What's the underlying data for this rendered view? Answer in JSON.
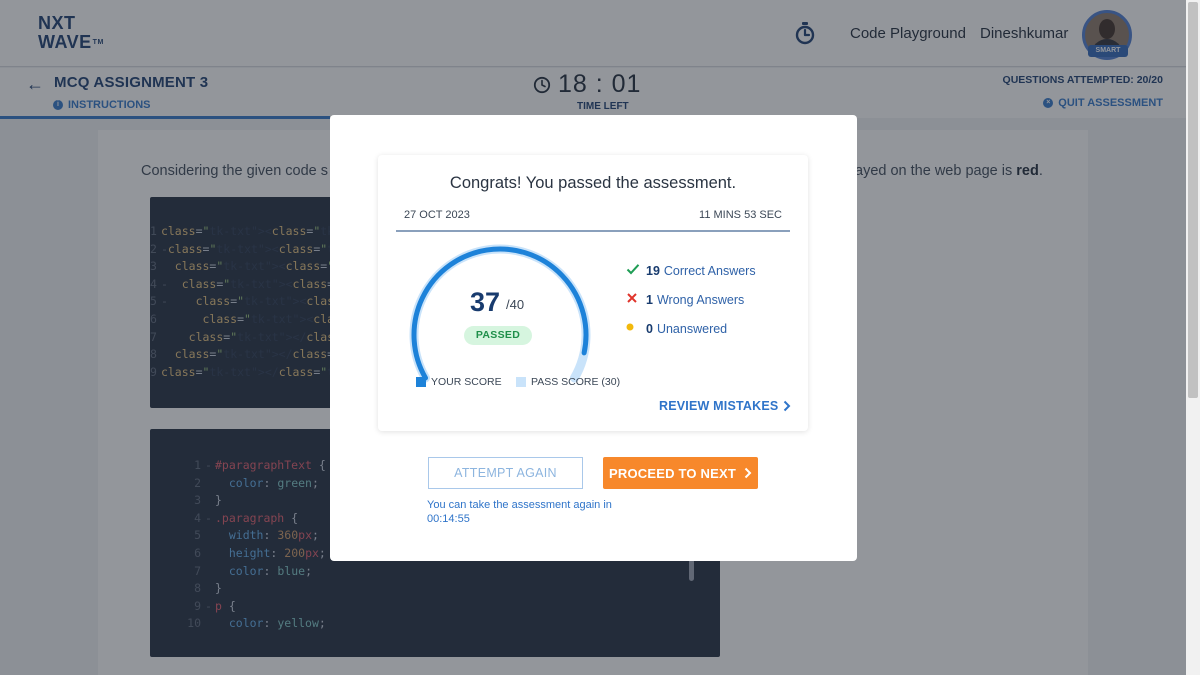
{
  "navbar": {
    "logo_line1": "NXT",
    "logo_line2": "WAVE",
    "logo_tm": "TM",
    "playground_label": "Code Playground",
    "user_name": "Dineshkumar",
    "avatar_badge": "SMART"
  },
  "assignment": {
    "title": "MCQ ASSIGNMENT 3",
    "instructions_label": "INSTRUCTIONS",
    "timer": "18 : 01",
    "time_left_label": "TIME LEFT",
    "attempted_label": "QUESTIONS ATTEMPTED: 20/20",
    "quit_label": "QUIT ASSESSMENT"
  },
  "question": {
    "text_start": "Considering the given code s",
    "text_end": "ayed on the web page is ",
    "text_bold": "red",
    "text_end_punct": "."
  },
  "code_html": {
    "lines": [
      {
        "n": "1",
        "fold": "",
        "code": "<!DOCTYPE html>"
      },
      {
        "n": "2",
        "fold": "-",
        "code": "<html>"
      },
      {
        "n": "3",
        "fold": "",
        "code": "  <head></head>"
      },
      {
        "n": "4",
        "fold": "-",
        "code": "  <body>"
      },
      {
        "n": "5",
        "fold": "-",
        "code": "    <div>"
      },
      {
        "n": "6",
        "fold": "",
        "code": "      <p class=\"p"
      },
      {
        "n": "7",
        "fold": "",
        "code": "    </div>"
      },
      {
        "n": "8",
        "fold": "",
        "code": "  </body>"
      },
      {
        "n": "9",
        "fold": "",
        "code": "</html>"
      }
    ]
  },
  "code_css": {
    "lines": [
      {
        "n": "1",
        "fold": "-",
        "code": "#paragraphText {"
      },
      {
        "n": "2",
        "fold": "",
        "code": "  color: green;"
      },
      {
        "n": "3",
        "fold": "",
        "code": "}"
      },
      {
        "n": "4",
        "fold": "-",
        "code": ".paragraph {"
      },
      {
        "n": "5",
        "fold": "",
        "code": "  width: 360px;"
      },
      {
        "n": "6",
        "fold": "",
        "code": "  height: 200px;"
      },
      {
        "n": "7",
        "fold": "",
        "code": "  color: blue;"
      },
      {
        "n": "8",
        "fold": "",
        "code": "}"
      },
      {
        "n": "9",
        "fold": "-",
        "code": "p {"
      },
      {
        "n": "10",
        "fold": "",
        "code": "  color: yellow;"
      }
    ]
  },
  "result": {
    "congrats": "Congrats! You passed the assessment.",
    "date": "27 OCT 2023",
    "duration": "11 MINS 53 SEC",
    "score": "37",
    "total": "/40",
    "score_value": 37,
    "max_score": 40,
    "pass_score": 30,
    "status": "PASSED",
    "correct_count": "19",
    "correct_label": "Correct Answers",
    "wrong_count": "1",
    "wrong_label": "Wrong Answers",
    "unanswered_count": "0",
    "unanswered_label": "Unanswered",
    "legend_your_score": "YOUR SCORE",
    "legend_pass_score": "PASS SCORE (30)",
    "review_label": "REVIEW MISTAKES",
    "colors": {
      "your_score": "#1d82d9",
      "pass_score": "#c9e3fa",
      "correct": "#1f9d55",
      "wrong": "#e0342b",
      "unanswered": "#f2b90c"
    }
  },
  "actions": {
    "attempt_again": "ATTEMPT AGAIN",
    "proceed": "PROCEED TO NEXT",
    "retake_note": "You can take the assessment again in 00:14:55"
  }
}
